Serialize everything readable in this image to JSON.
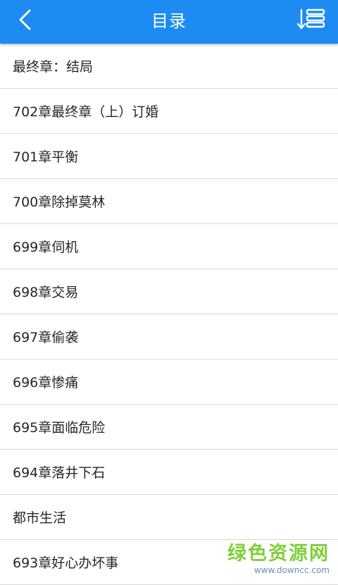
{
  "header": {
    "title": "目录",
    "back_icon": "chevron-left-icon",
    "sort_icon": "sort-order-icon",
    "background": "#1e8bf3"
  },
  "chapters": [
    {
      "label": "最终章：结局"
    },
    {
      "label": "702章最终章（上）订婚"
    },
    {
      "label": "701章平衡"
    },
    {
      "label": "700章除掉莫林"
    },
    {
      "label": "699章伺机"
    },
    {
      "label": "698章交易"
    },
    {
      "label": "697章偷袭"
    },
    {
      "label": "696章惨痛"
    },
    {
      "label": "695章面临危险"
    },
    {
      "label": "694章落井下石"
    },
    {
      "label": "都市生活"
    },
    {
      "label": "693章好心办坏事"
    }
  ],
  "watermark": {
    "main": "绿色资源网",
    "url": "www.downcc.com"
  }
}
